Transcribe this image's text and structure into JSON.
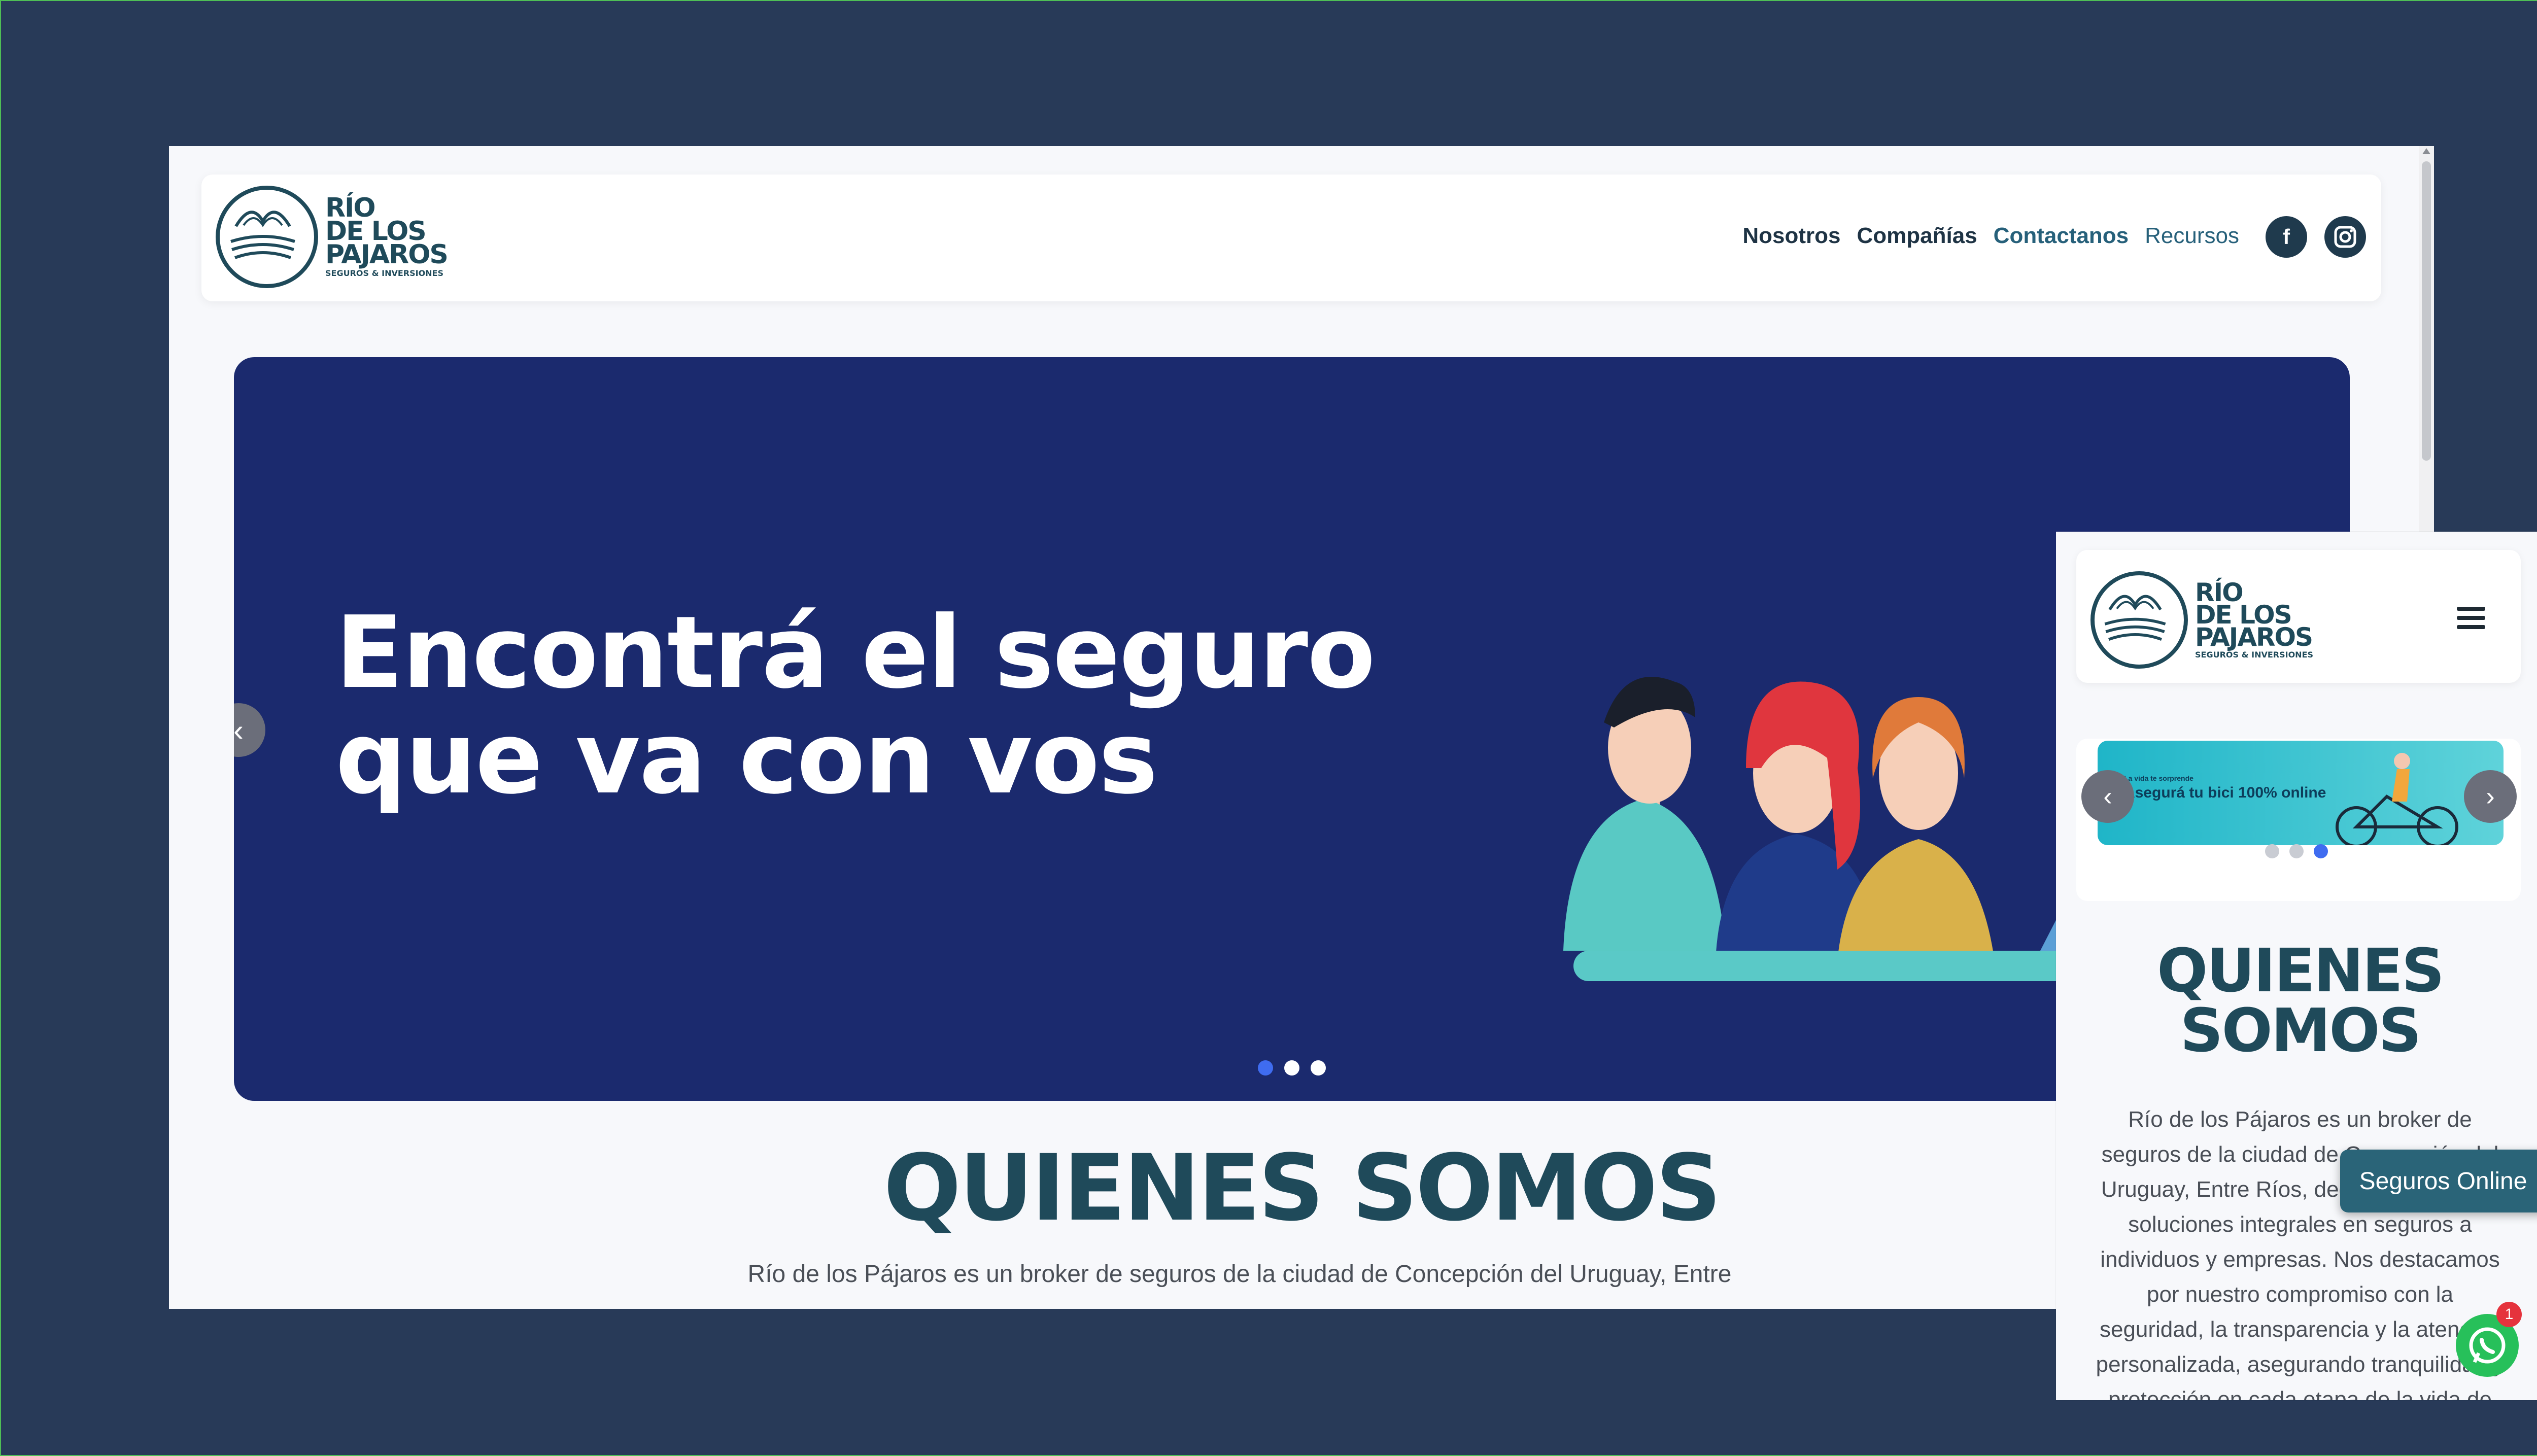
{
  "desktop": {
    "logo": {
      "line1": "RÍO",
      "line2": "DE LOS",
      "line3": "PAJAROS",
      "sub": "SEGUROS & INVERSIONES"
    },
    "nav": {
      "items": [
        "Nosotros",
        "Compañías",
        "Contactanos",
        "Recursos"
      ]
    },
    "social": {
      "facebook": "f",
      "instagram": "◎"
    },
    "hero": {
      "title_line1": "Encontrá el seguro",
      "title_line2": "que va con vos",
      "prev": "‹",
      "slide_count": 3,
      "active_slide": 1
    },
    "about": {
      "title": "QUIENES SOMOS",
      "text": "Río de los Pájaros es un broker de seguros de la ciudad de Concepción del Uruguay, Entre"
    }
  },
  "mobile": {
    "logo": {
      "line1": "RÍO",
      "line2": "DE LOS",
      "line3": "PAJAROS",
      "sub": "SEGUROS & INVERSIONES"
    },
    "banner": {
      "small": "La vida te sorprende",
      "text": "Asegurá tu bici 100% online",
      "prev": "‹",
      "next": "›",
      "slide_count": 3,
      "active_slide": 3
    },
    "about": {
      "title_line1": "QUIENES",
      "title_line2": "SOMOS",
      "lines": [
        "Río de los Pájaros es un broker de",
        "seguros de la ciudad de Concepción del",
        "Uruguay, Entre Ríos, dedicado a brindar",
        "soluciones integrales en seguros a",
        "individuos y empresas. Nos destacamos",
        "por nuestro compromiso con la",
        "seguridad, la transparencia y la atención",
        "personalizada, asegurando tranquilidad y",
        "protección en cada etapa de la vida de"
      ]
    }
  },
  "floating": {
    "seguros_online": "Seguros Online",
    "whatsapp_badge": "1"
  },
  "colors": {
    "brand": "#1f4a5a",
    "hero_bg": "#1b2a6e",
    "accent_dot": "#3f6cf0",
    "whatsapp": "#27c05a"
  }
}
